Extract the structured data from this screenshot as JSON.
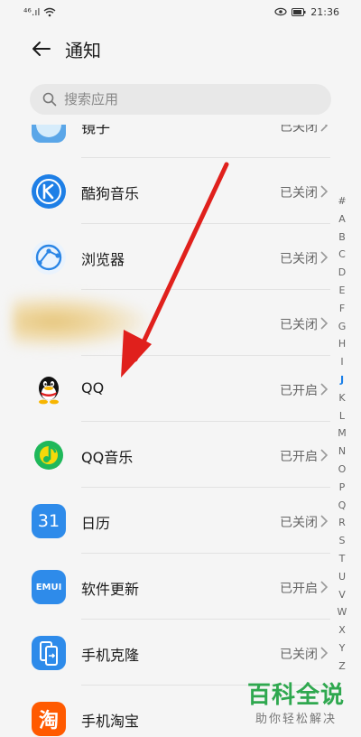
{
  "status_bar": {
    "signal": "⁴⁶.ıl",
    "wifi": "wifi-icon",
    "time": "21:36"
  },
  "header": {
    "title": "通知"
  },
  "search": {
    "placeholder": "搜索应用"
  },
  "apps": [
    {
      "name": "镜子",
      "status": "已关闭",
      "icon": "mirror-app-icon"
    },
    {
      "name": "酷狗音乐",
      "status": "已关闭",
      "icon": "kugou-app-icon"
    },
    {
      "name": "浏览器",
      "status": "已关闭",
      "icon": "browser-app-icon"
    },
    {
      "name": "",
      "status": "已关闭",
      "icon": "blurred-app-icon"
    },
    {
      "name": "QQ",
      "status": "已开启",
      "icon": "qq-app-icon"
    },
    {
      "name": "QQ音乐",
      "status": "已开启",
      "icon": "qqmusic-app-icon"
    },
    {
      "name": "日历",
      "status": "已关闭",
      "icon": "calendar-app-icon",
      "icon_text": "31"
    },
    {
      "name": "软件更新",
      "status": "已开启",
      "icon": "emui-update-app-icon",
      "icon_text": "EMUI"
    },
    {
      "name": "手机克隆",
      "status": "已关闭",
      "icon": "phone-clone-app-icon"
    },
    {
      "name": "手机淘宝",
      "status": "已关闭",
      "icon": "taobao-app-icon",
      "icon_text": "淘"
    }
  ],
  "index_letters": [
    "#",
    "A",
    "B",
    "C",
    "D",
    "E",
    "F",
    "G",
    "H",
    "I",
    "J",
    "K",
    "L",
    "M",
    "N",
    "O",
    "P",
    "Q",
    "R",
    "S",
    "T",
    "U",
    "V",
    "W",
    "X",
    "Y",
    "Z"
  ],
  "index_active": "J",
  "colors": {
    "accent": "#1a7fe8",
    "annotation_arrow": "#e0201c",
    "watermark": "#2fa84f"
  },
  "watermark": {
    "title": "百科全说",
    "subtitle": "助你轻松解决"
  }
}
